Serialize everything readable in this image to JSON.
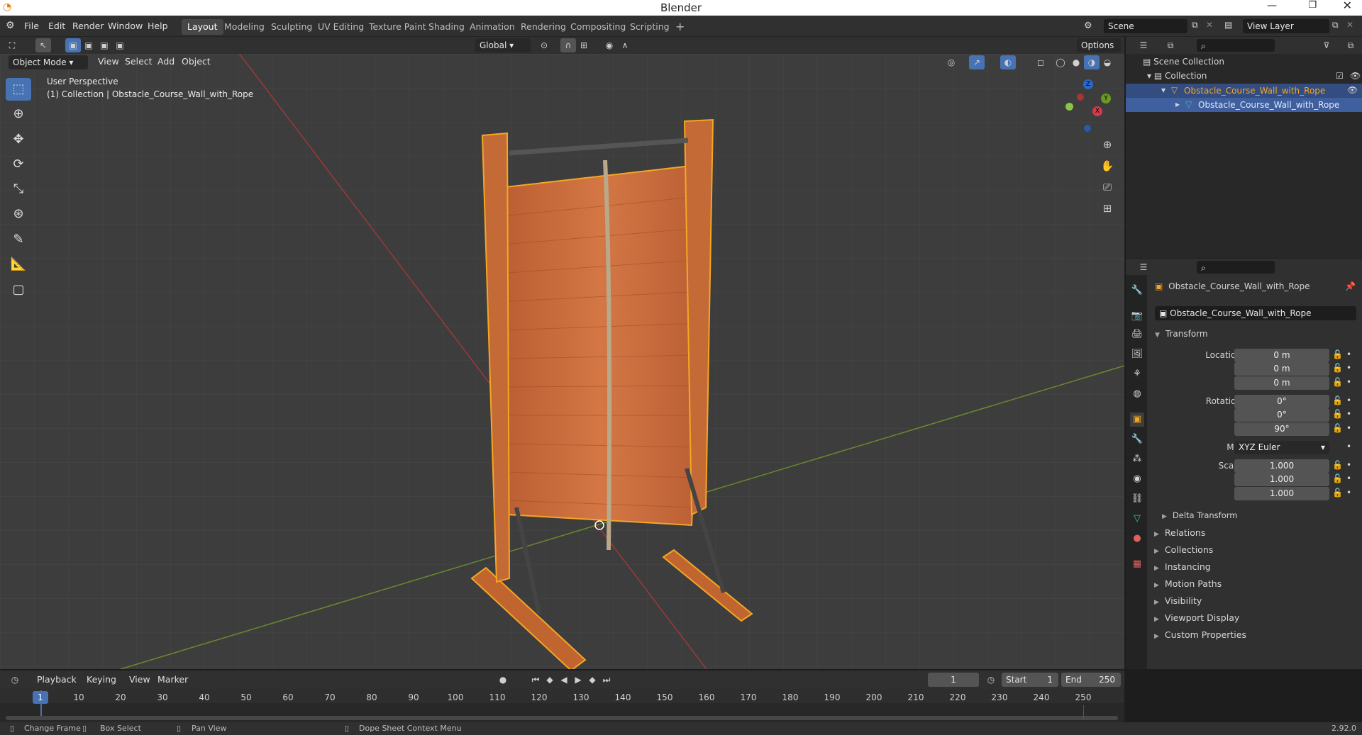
{
  "window": {
    "title": "Blender"
  },
  "menu": [
    "File",
    "Edit",
    "Render",
    "Window",
    "Help"
  ],
  "workspaces": [
    "Layout",
    "Modeling",
    "Sculpting",
    "UV Editing",
    "Texture Paint",
    "Shading",
    "Animation",
    "Rendering",
    "Compositing",
    "Scripting"
  ],
  "scene": "Scene",
  "view_layer": "View Layer",
  "viewport": {
    "transform_orientation": "Global",
    "options": "Options",
    "mode": "Object Mode",
    "menus": [
      "View",
      "Select",
      "Add",
      "Object"
    ],
    "perspective": "User Perspective",
    "collection_info": "(1) Collection | Obstacle_Course_Wall_with_Rope"
  },
  "gizmo": {
    "x": "X",
    "y": "Y",
    "z": "Z"
  },
  "outliner": {
    "items": [
      "Scene Collection",
      "Collection",
      "Obstacle_Course_Wall_with_Rope",
      "Obstacle_Course_Wall_with_Rope"
    ]
  },
  "properties": {
    "object_name": "Obstacle_Course_Wall_with_Rope",
    "object_field": "Obstacle_Course_Wall_with_Rope",
    "transform_title": "Transform",
    "location": {
      "label": "Location X",
      "x": "0 m",
      "y": "0 m",
      "z": "0 m"
    },
    "rotation": {
      "label": "Rotation X",
      "x": "0°",
      "y": "0°",
      "z": "90°"
    },
    "mode": {
      "label": "Mode",
      "value": "XYZ Euler"
    },
    "scale": {
      "label": "Scale X",
      "x": "1.000",
      "y": "1.000",
      "z": "1.000"
    },
    "axis_y": "Y",
    "axis_z": "Z",
    "delta": "Delta Transform",
    "panels": [
      "Relations",
      "Collections",
      "Instancing",
      "Motion Paths",
      "Visibility",
      "Viewport Display",
      "Custom Properties"
    ]
  },
  "timeline": {
    "menus": [
      "Playback",
      "Keying",
      "View",
      "Marker"
    ],
    "current_frame": "1",
    "start_label": "Start",
    "start": "1",
    "end_label": "End",
    "end": "250",
    "ticks": [
      "1",
      "10",
      "20",
      "30",
      "40",
      "50",
      "60",
      "70",
      "80",
      "90",
      "100",
      "110",
      "120",
      "130",
      "140",
      "150",
      "160",
      "170",
      "180",
      "190",
      "200",
      "210",
      "220",
      "230",
      "240",
      "250"
    ]
  },
  "status": {
    "items": [
      "Change Frame",
      "Box Select",
      "Pan View",
      "Dope Sheet Context Menu"
    ],
    "version": "2.92.0"
  },
  "colors": {
    "accent": "#4772b3",
    "selected_outline": "#f5a623",
    "wood": "#c8673a"
  }
}
